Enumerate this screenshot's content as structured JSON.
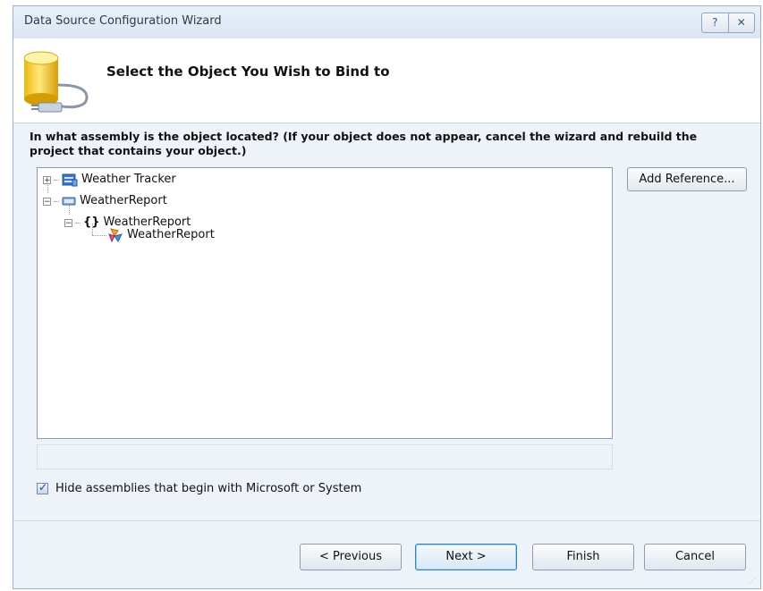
{
  "window": {
    "title": "Data Source Configuration Wizard",
    "help_glyph": "?",
    "close_glyph": "✕"
  },
  "banner": {
    "title": "Select the Object You Wish to Bind to",
    "icon": "database-plug-icon"
  },
  "prompt": {
    "question": "In what assembly is the object located? (If your object does not appear, cancel the wizard and rebuild the project that contains your object.)"
  },
  "tree": {
    "nodes": [
      {
        "label": "Weather Tracker",
        "icon": "project-icon",
        "expander": "+"
      },
      {
        "label": "WeatherReport",
        "icon": "assembly-icon",
        "expander": "−"
      },
      {
        "label": "WeatherReport",
        "icon": "namespace-icon",
        "icon_glyph": "{}",
        "expander": "−"
      },
      {
        "label": "WeatherReport",
        "icon": "class-icon"
      }
    ]
  },
  "side": {
    "add_reference_label": "Add Reference..."
  },
  "options": {
    "hide_assemblies_label": "Hide assemblies that begin with Microsoft or System",
    "hide_assemblies_checked": true
  },
  "footer": {
    "previous_label": "< Previous",
    "next_label": "Next >",
    "finish_label": "Finish",
    "cancel_label": "Cancel"
  }
}
